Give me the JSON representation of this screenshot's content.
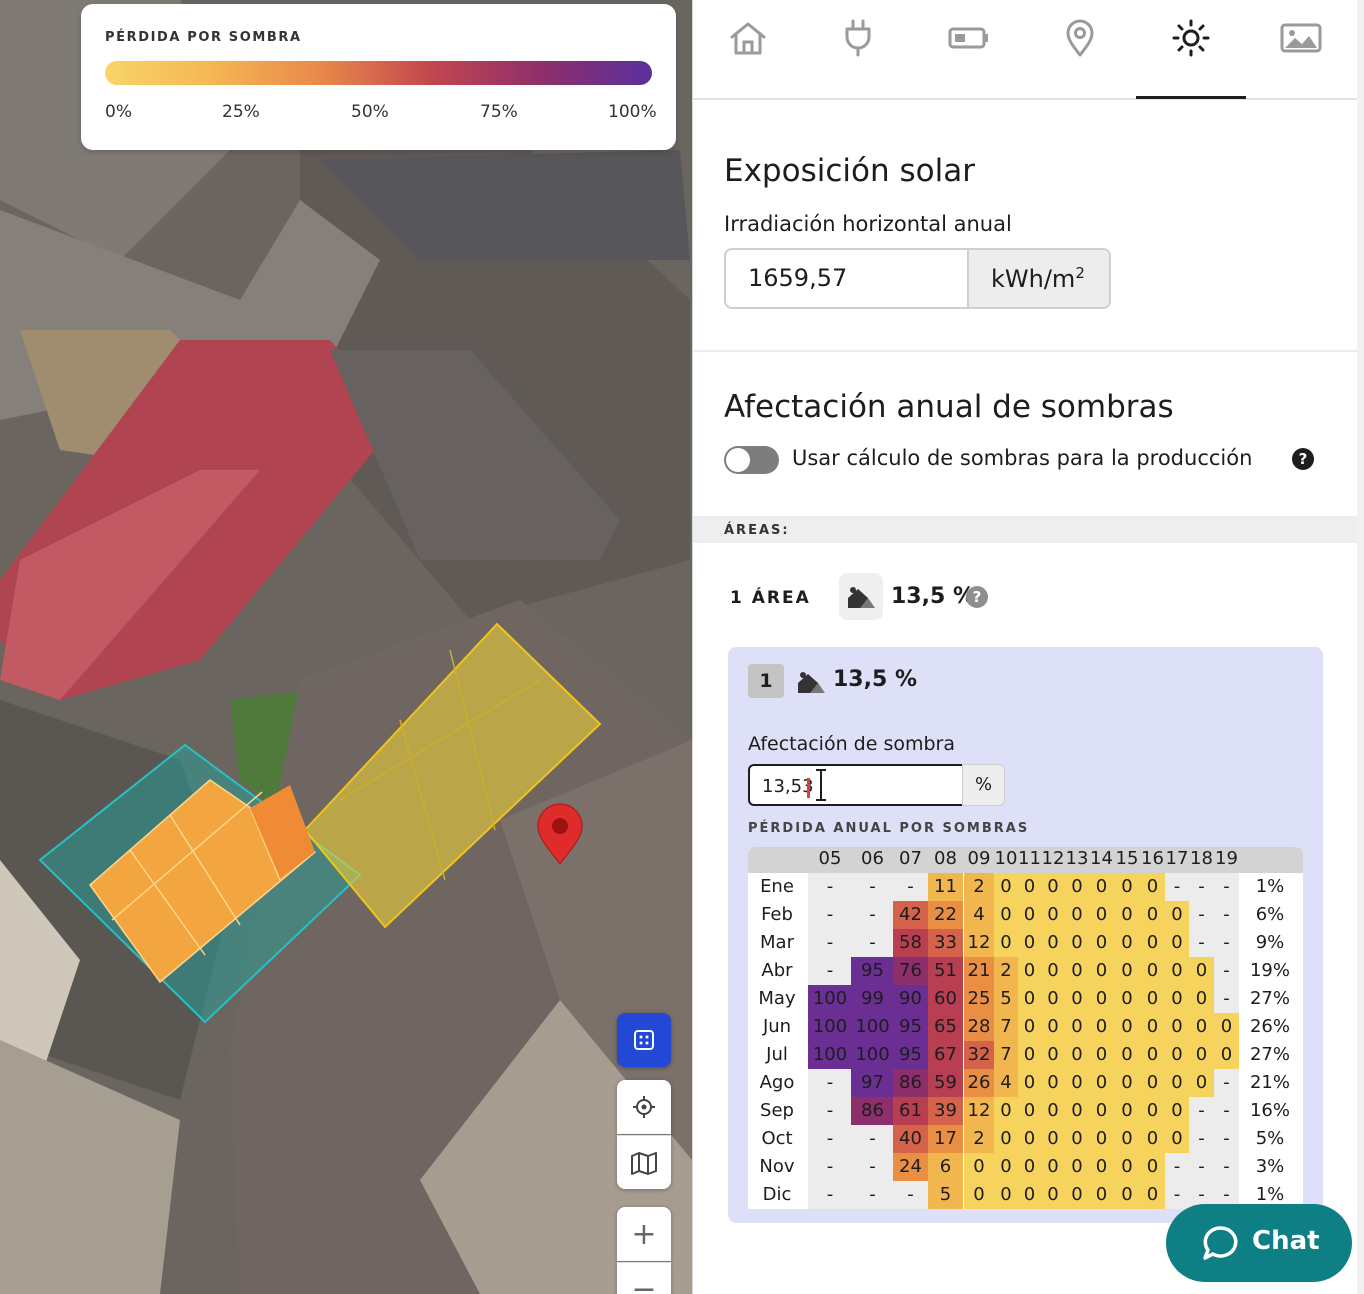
{
  "legend": {
    "title": "PÉRDIDA POR SOMBRA",
    "ticks": [
      "0%",
      "25%",
      "50%",
      "75%",
      "100%"
    ],
    "gradient_colors": [
      "#f8d46a",
      "#e7874a",
      "#c2454e",
      "#8d2f6a",
      "#5a2f9e"
    ]
  },
  "map": {
    "controls": [
      "grid-toggle-icon",
      "locate-icon",
      "map-type-icon",
      "zoom-in-icon",
      "zoom-out-icon"
    ],
    "zoom_in_label": "+",
    "zoom_out_label": "−",
    "marker_color": "#e02b2b",
    "panel_colors": {
      "orange_array": "#f3a53f",
      "teal_area": "#2a9a94",
      "yellow_area": "#e8cb3a"
    }
  },
  "tabs": [
    {
      "icon": "home-icon",
      "active": false
    },
    {
      "icon": "plug-icon",
      "active": false
    },
    {
      "icon": "battery-icon",
      "active": false
    },
    {
      "icon": "location-pin-icon",
      "active": false
    },
    {
      "icon": "sun-icon",
      "active": true
    },
    {
      "icon": "image-icon",
      "active": false
    }
  ],
  "solar": {
    "title": "Exposición solar",
    "irradiation_label": "Irradiación horizontal anual",
    "irradiation_value": "1659,57",
    "irradiation_unit": "kWh/m",
    "irradiation_unit_exp": "2"
  },
  "shadows": {
    "title": "Afectación anual de sombras",
    "toggle_label": "Usar cálculo de sombras para la producción",
    "toggle_on": false,
    "help": "?",
    "areas_header": "ÁREAS:",
    "area_count": "1 ÁREA",
    "area_total": "13,5 %"
  },
  "area_card": {
    "badge": "1",
    "percent": "13,5 %",
    "shade_label": "Afectación de sombra",
    "shade_value": "13,53",
    "shade_unit": "%",
    "table_title": "PÉRDIDA ANUAL POR SOMBRAS"
  },
  "shade_table": {
    "hours": [
      "05",
      "06",
      "07",
      "08",
      "09",
      "10",
      "11",
      "12",
      "13",
      "14",
      "15",
      "16",
      "17",
      "18",
      "19"
    ],
    "rows": [
      {
        "month": "Ene",
        "values": [
          "-",
          "-",
          "-",
          "11",
          "2",
          "0",
          "0",
          "0",
          "0",
          "0",
          "0",
          "0",
          "-",
          "-",
          "-"
        ],
        "total": "1%"
      },
      {
        "month": "Feb",
        "values": [
          "-",
          "-",
          "42",
          "22",
          "4",
          "0",
          "0",
          "0",
          "0",
          "0",
          "0",
          "0",
          "0",
          "-",
          "-"
        ],
        "total": "6%"
      },
      {
        "month": "Mar",
        "values": [
          "-",
          "-",
          "58",
          "33",
          "12",
          "0",
          "0",
          "0",
          "0",
          "0",
          "0",
          "0",
          "0",
          "-",
          "-"
        ],
        "total": "9%"
      },
      {
        "month": "Abr",
        "values": [
          "-",
          "95",
          "76",
          "51",
          "21",
          "2",
          "0",
          "0",
          "0",
          "0",
          "0",
          "0",
          "0",
          "0",
          "-"
        ],
        "total": "19%"
      },
      {
        "month": "May",
        "values": [
          "100",
          "99",
          "90",
          "60",
          "25",
          "5",
          "0",
          "0",
          "0",
          "0",
          "0",
          "0",
          "0",
          "0",
          "-"
        ],
        "total": "27%"
      },
      {
        "month": "Jun",
        "values": [
          "100",
          "100",
          "95",
          "65",
          "28",
          "7",
          "0",
          "0",
          "0",
          "0",
          "0",
          "0",
          "0",
          "0",
          "0"
        ],
        "total": "26%"
      },
      {
        "month": "Jul",
        "values": [
          "100",
          "100",
          "95",
          "67",
          "32",
          "7",
          "0",
          "0",
          "0",
          "0",
          "0",
          "0",
          "0",
          "0",
          "0"
        ],
        "total": "27%"
      },
      {
        "month": "Ago",
        "values": [
          "-",
          "97",
          "86",
          "59",
          "26",
          "4",
          "0",
          "0",
          "0",
          "0",
          "0",
          "0",
          "0",
          "0",
          "-"
        ],
        "total": "21%"
      },
      {
        "month": "Sep",
        "values": [
          "-",
          "86",
          "61",
          "39",
          "12",
          "0",
          "0",
          "0",
          "0",
          "0",
          "0",
          "0",
          "0",
          "-",
          "-"
        ],
        "total": "16%"
      },
      {
        "month": "Oct",
        "values": [
          "-",
          "-",
          "40",
          "17",
          "2",
          "0",
          "0",
          "0",
          "0",
          "0",
          "0",
          "0",
          "0",
          "-",
          "-"
        ],
        "total": "5%"
      },
      {
        "month": "Nov",
        "values": [
          "-",
          "-",
          "24",
          "6",
          "0",
          "0",
          "0",
          "0",
          "0",
          "0",
          "0",
          "0",
          "-",
          "-",
          "-"
        ],
        "total": "3%"
      },
      {
        "month": "Dic",
        "values": [
          "-",
          "-",
          "-",
          "5",
          "0",
          "0",
          "0",
          "0",
          "0",
          "0",
          "0",
          "0",
          "-",
          "-",
          "-"
        ],
        "total": "1%"
      }
    ]
  },
  "chat": {
    "label": "Chat"
  }
}
